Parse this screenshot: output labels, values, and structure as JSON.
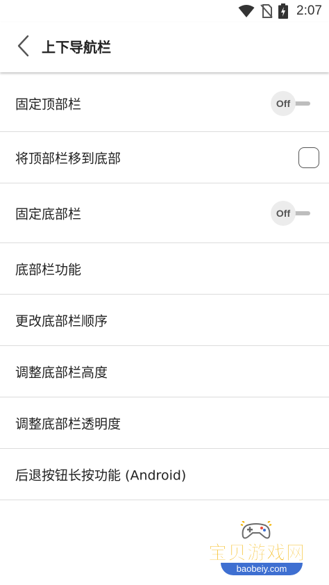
{
  "status_bar": {
    "time": "2:07",
    "icons": [
      "wifi-icon",
      "no-sim-icon",
      "battery-icon"
    ]
  },
  "header": {
    "back_icon": "chevron-left-icon",
    "title": "上下导航栏"
  },
  "settings": [
    {
      "label": "固定顶部栏",
      "control": "toggle",
      "state": "Off"
    },
    {
      "label": "将顶部栏移到底部",
      "control": "checkbox",
      "checked": false
    },
    {
      "label": "固定底部栏",
      "control": "toggle",
      "state": "Off"
    },
    {
      "label": "底部栏功能",
      "control": "none"
    },
    {
      "label": "更改底部栏顺序",
      "control": "none"
    },
    {
      "label": "调整底部栏高度",
      "control": "none"
    },
    {
      "label": "调整底部栏透明度",
      "control": "none"
    },
    {
      "label": "后退按钮长按功能 (Android)",
      "control": "none"
    }
  ],
  "watermark": {
    "title": "宝贝游戏网",
    "url": "baobeiy.com"
  },
  "colors": {
    "background": "#ffffff",
    "divider": "#dcdcdc",
    "toggle_knob": "#ececec",
    "toggle_track": "#bdbdbd",
    "watermark_yellow": "#f4b400",
    "watermark_blue": "#3e6fd1"
  }
}
